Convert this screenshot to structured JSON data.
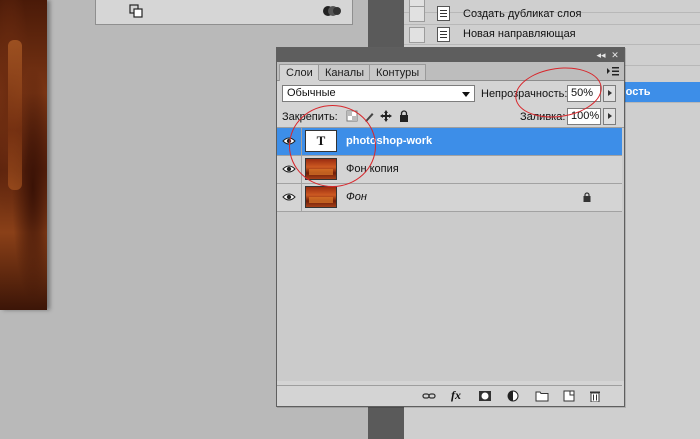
{
  "history": {
    "items": [
      {
        "label": "Создать дубликат слоя",
        "selected": false
      },
      {
        "label": "Новая направляющая",
        "selected": false
      },
      {
        "label": "",
        "selected": false
      },
      {
        "label": "ность",
        "selected": true
      }
    ]
  },
  "layers_panel": {
    "tabs": [
      {
        "label": "Слои",
        "active": true
      },
      {
        "label": "Каналы",
        "active": false
      },
      {
        "label": "Контуры",
        "active": false
      }
    ],
    "blend_mode": "Обычные",
    "opacity_label": "Непрозрачность:",
    "opacity_value": "50%",
    "lock_label": "Закрепить:",
    "fill_label": "Заливка:",
    "fill_value": "100%",
    "layers": [
      {
        "name": "photoshop-work",
        "type": "text",
        "thumb_glyph": "T",
        "selected": true,
        "locked": false
      },
      {
        "name": "Фон копия",
        "type": "image",
        "selected": false,
        "locked": false
      },
      {
        "name": "Фон",
        "type": "image",
        "selected": false,
        "locked": true,
        "italic": true
      }
    ],
    "bottom_icons": [
      "link-icon",
      "fx-icon",
      "mask-icon",
      "adjustment-icon",
      "group-folder-icon",
      "new-layer-icon",
      "trash-icon"
    ],
    "fx_glyph": "fx"
  },
  "colors": {
    "selection": "#3d8ee8",
    "annotation": "#d8262b",
    "panel_bg": "#d4d4d4"
  }
}
